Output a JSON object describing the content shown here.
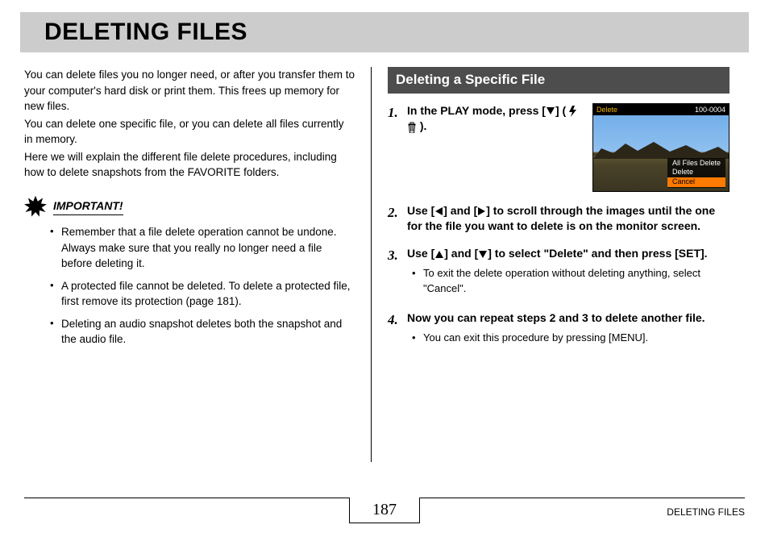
{
  "title": "DELETING FILES",
  "intro": {
    "p1": "You can delete files you no longer need, or after you transfer them to your computer's hard disk or print them. This frees up memory for new files.",
    "p2": "You can delete one specific file, or you can delete all files currently in memory.",
    "p3": "Here we will explain the different file delete procedures, including how to delete snapshots from the FAVORITE folders."
  },
  "important": {
    "label": "IMPORTANT!",
    "items": [
      "Remember that a file delete operation cannot be undone. Always make sure that you really no longer need a file before deleting it.",
      "A protected file cannot be deleted. To delete a protected file, first remove its protection (page 181).",
      "Deleting an audio snapshot deletes both the snapshot and the audio file."
    ]
  },
  "section": {
    "header": "Deleting a Specific File",
    "steps": {
      "s1_pre": "In the PLAY mode, press [",
      "s1_mid": "] ( ",
      "s1_post": " ).",
      "s2a": "Use [",
      "s2b": "] and [",
      "s2c": "] to scroll through the images until the one for the file you want to delete is on the monitor screen.",
      "s3a": "Use [",
      "s3b": "] and [",
      "s3c": "] to select \"Delete\" and then press [SET].",
      "s3_sub": "To exit the delete operation without deleting anything, select \"Cancel\".",
      "s4": "Now you can repeat steps 2 and 3 to delete another file.",
      "s4_sub": "You can exit this procedure by pressing [MENU]."
    },
    "step_numbers": {
      "n1": "1.",
      "n2": "2.",
      "n3": "3.",
      "n4": "4."
    }
  },
  "screenshot": {
    "top_left": "Delete",
    "top_right": "100-0004",
    "menu": [
      "All Files Delete",
      "Delete",
      "Cancel"
    ]
  },
  "footer": {
    "page": "187",
    "right": "DELETING FILES"
  }
}
